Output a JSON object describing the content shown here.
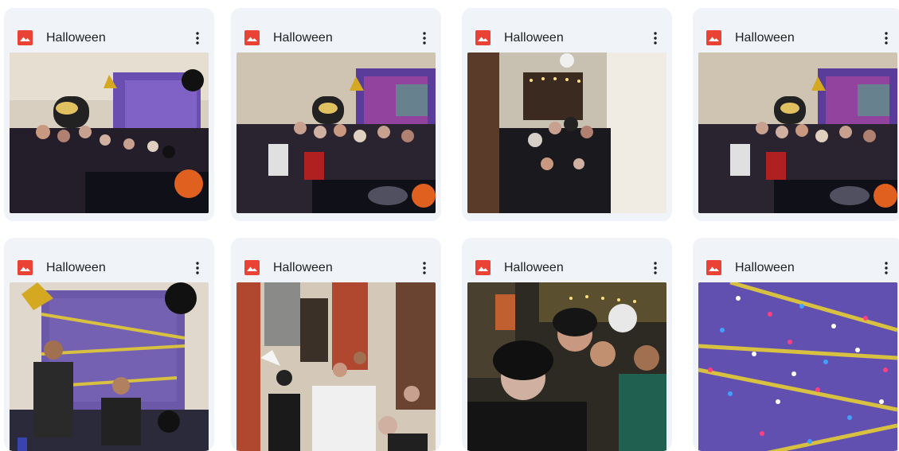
{
  "cards": [
    {
      "title": "Halloween",
      "thumbnail": "halloween-party-group-photo"
    },
    {
      "title": "Halloween",
      "thumbnail": "halloween-party-group-photo"
    },
    {
      "title": "Halloween",
      "thumbnail": "halloween-party-hallway-photo"
    },
    {
      "title": "Halloween",
      "thumbnail": "halloween-party-group-photo"
    },
    {
      "title": "Halloween",
      "thumbnail": "halloween-party-couple-photo"
    },
    {
      "title": "Halloween",
      "thumbnail": "halloween-party-table-photo"
    },
    {
      "title": "Halloween",
      "thumbnail": "halloween-party-facepaint-photo"
    },
    {
      "title": "Halloween",
      "thumbnail": "halloween-decorations-lights-photo"
    }
  ],
  "icons": {
    "file_type": "image-file-icon",
    "menu": "more-vert-icon"
  },
  "colors": {
    "card_bg": "#f0f4f9",
    "image_icon_red": "#ea4335",
    "title_text": "#1f1f1f"
  }
}
